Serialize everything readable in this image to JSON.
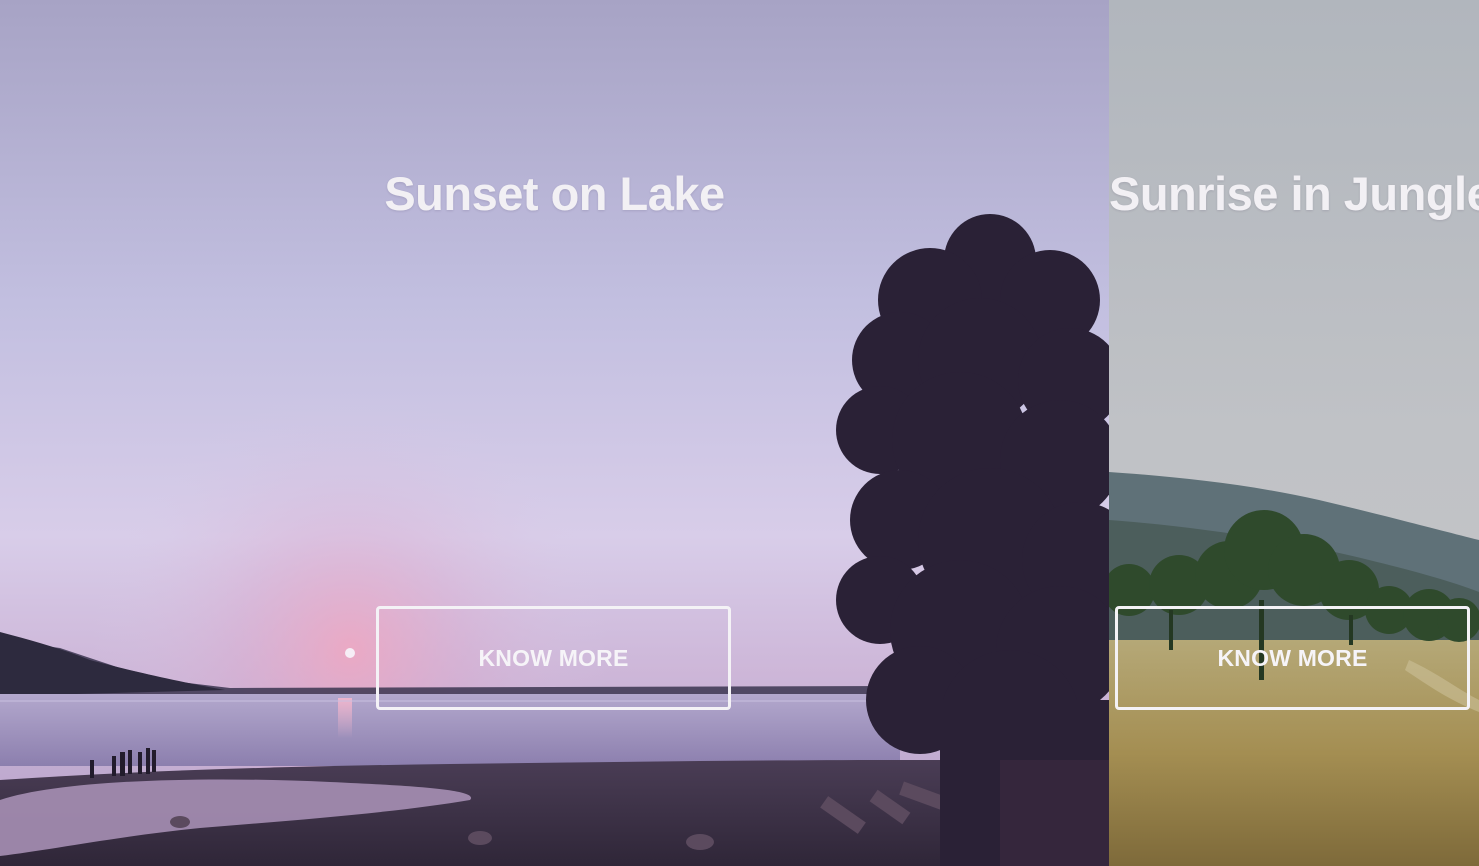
{
  "slides": [
    {
      "title": "Sunset on Lake",
      "button_label": "KNOW MORE"
    },
    {
      "title": "Sunrise in Jungle",
      "button_label": "KNOW MORE"
    }
  ],
  "colors": {
    "sky_top": "#a8a4c6",
    "sky_mid": "#d6cde8",
    "sun_glow": "#e8a8c4",
    "tree_silhouette": "#2a2136",
    "jungle_sky": "#b9bdc3",
    "grass": "#a89254"
  }
}
